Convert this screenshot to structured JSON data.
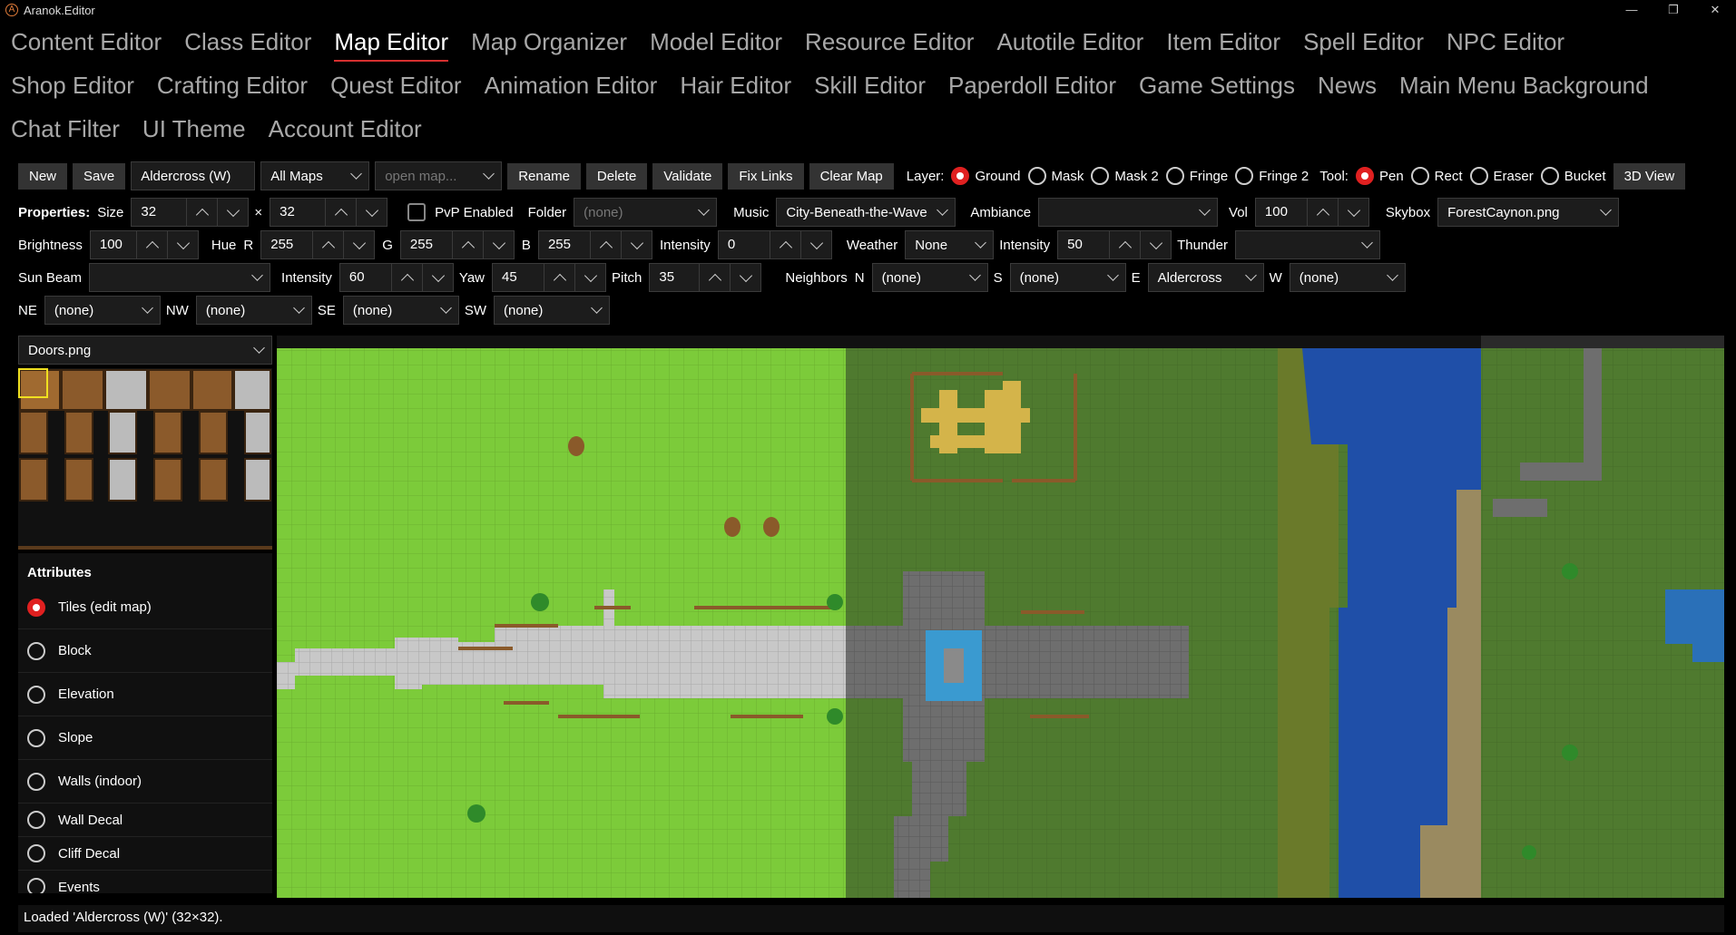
{
  "window": {
    "title": "Aranok.Editor",
    "icon": "A"
  },
  "tabs": [
    "Content Editor",
    "Class Editor",
    "Map Editor",
    "Map Organizer",
    "Model Editor",
    "Resource Editor",
    "Autotile Editor",
    "Item Editor",
    "Spell Editor",
    "NPC Editor",
    "Shop Editor",
    "Crafting Editor",
    "Quest Editor",
    "Animation Editor",
    "Hair Editor",
    "Skill Editor",
    "Paperdoll Editor",
    "Game Settings",
    "News",
    "Main Menu Background",
    "Chat Filter",
    "UI Theme",
    "Account Editor"
  ],
  "active_tab": "Map Editor",
  "toolbar": {
    "new": "New",
    "save": "Save",
    "map_name": "Aldercross (W)",
    "map_filter": "All Maps",
    "open_map_placeholder": "open map...",
    "rename": "Rename",
    "delete": "Delete",
    "validate": "Validate",
    "fix_links": "Fix Links",
    "clear_map": "Clear Map",
    "layer_label": "Layer:",
    "layers": [
      "Ground",
      "Mask",
      "Mask 2",
      "Fringe",
      "Fringe 2"
    ],
    "layer_selected": "Ground",
    "tool_label": "Tool:",
    "tools": [
      "Pen",
      "Rect",
      "Eraser",
      "Bucket"
    ],
    "tool_selected": "Pen",
    "view3d": "3D View"
  },
  "properties": {
    "label": "Properties:",
    "size_label": "Size",
    "size_w": "32",
    "size_x": "×",
    "size_h": "32",
    "pvp_label": "PvP Enabled",
    "folder_label": "Folder",
    "folder_placeholder": "(none)",
    "music_label": "Music",
    "music": "City-Beneath-the-Wave",
    "ambiance_label": "Ambiance",
    "ambiance": "",
    "vol_label": "Vol",
    "vol": "100",
    "skybox_label": "Skybox",
    "skybox": "ForestCaynon.png",
    "brightness_label": "Brightness",
    "brightness": "100",
    "hue_label": "Hue",
    "r_label": "R",
    "r": "255",
    "g_label": "G",
    "g": "255",
    "b_label": "B",
    "b": "255",
    "intensity_label": "Intensity",
    "intensity": "0",
    "weather_label": "Weather",
    "weather": "None",
    "weather_intensity": "50",
    "thunder_label": "Thunder",
    "thunder": "",
    "sunbeam_label": "Sun Beam",
    "sunbeam": "",
    "sun_intensity": "60",
    "yaw_label": "Yaw",
    "yaw": "45",
    "pitch_label": "Pitch",
    "pitch": "35",
    "neighbors_label": "Neighbors",
    "n_label": "N",
    "n": "(none)",
    "s_label": "S",
    "s": "(none)",
    "e_label": "E",
    "e": "Aldercross",
    "w_label": "W",
    "w": "(none)",
    "ne_label": "NE",
    "ne": "(none)",
    "nw_label": "NW",
    "nw": "(none)",
    "se_label": "SE",
    "se": "(none)",
    "sw_label": "SW",
    "sw": "(none)"
  },
  "tileset": "Doors.png",
  "attributes": {
    "title": "Attributes",
    "items": [
      "Tiles (edit map)",
      "Block",
      "Elevation",
      "Slope",
      "Walls (indoor)",
      "Wall Decal",
      "Cliff Decal",
      "Events"
    ],
    "selected": "Tiles (edit map)"
  },
  "status": "Loaded 'Aldercross (W)' (32×32).",
  "colors": {
    "accent": "#d62f2f",
    "grass_light": "#7ccb3a",
    "grass_dark": "#4f7a2f",
    "water": "#1f4fa8",
    "stone": "#7a7a7a"
  }
}
